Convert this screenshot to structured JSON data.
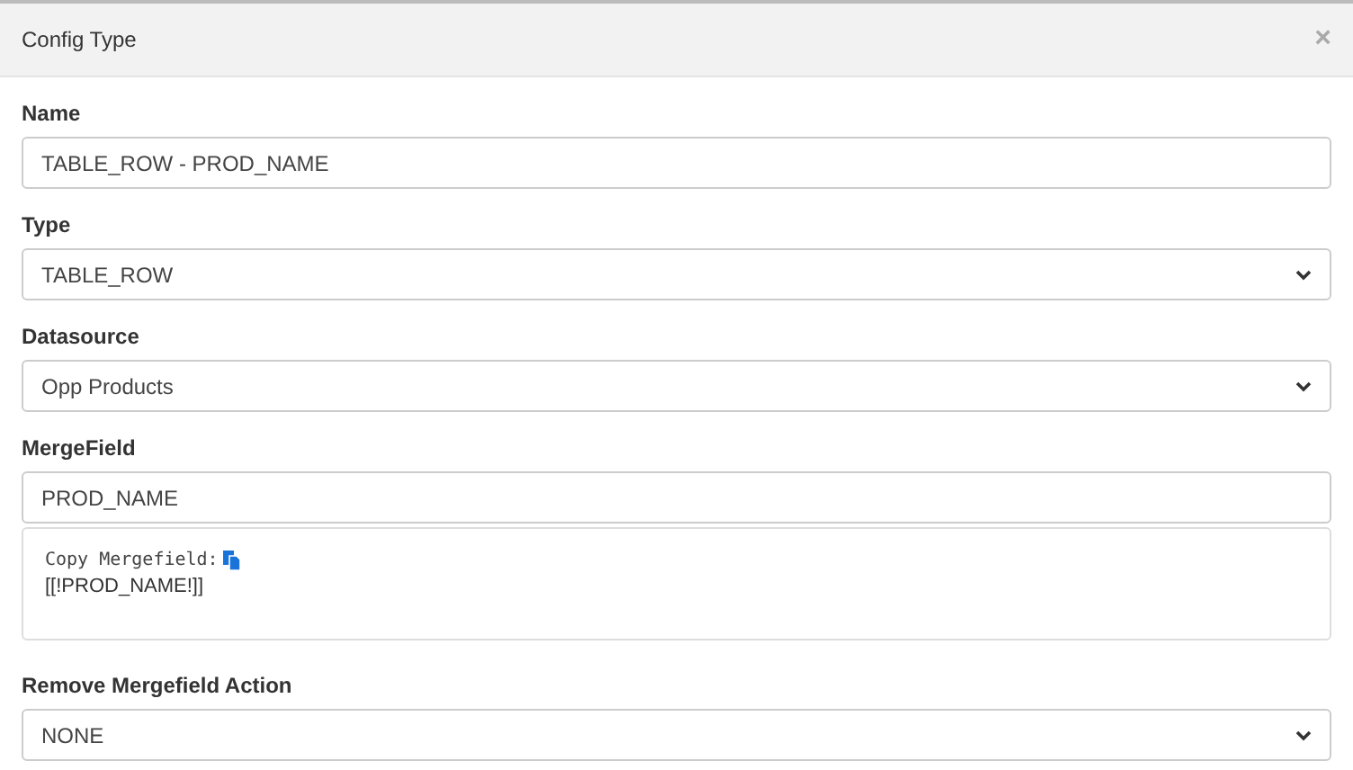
{
  "dialog": {
    "title": "Config Type",
    "close": "×"
  },
  "fields": [
    {
      "kind": "text",
      "label": "Name",
      "value": "TABLE_ROW - PROD_NAME"
    },
    {
      "kind": "select",
      "label": "Type",
      "value": "TABLE_ROW"
    },
    {
      "kind": "select",
      "label": "Datasource",
      "value": "Opp Products"
    },
    {
      "kind": "text",
      "label": "MergeField",
      "value": "PROD_NAME"
    },
    {
      "kind": "info",
      "caption": "Copy Mergefield:",
      "code": "[[!PROD_NAME!]]"
    },
    {
      "kind": "select",
      "label": "Remove Mergefield Action",
      "value": "NONE"
    }
  ]
}
